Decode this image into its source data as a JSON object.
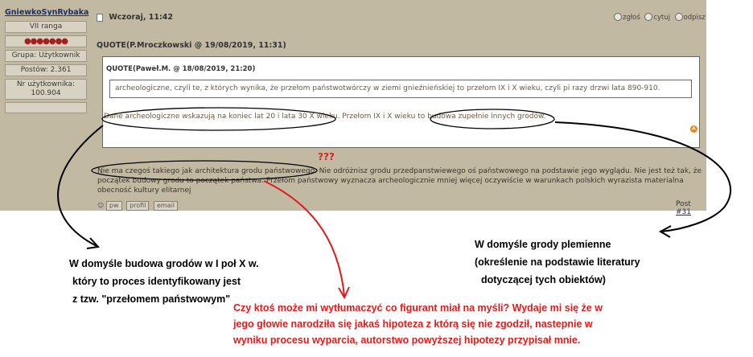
{
  "user": {
    "name": "GniewkoSynRybaka",
    "rank": "VII ranga",
    "group": "Grupa: Użytkownik",
    "posts": "Postów: 2.361",
    "number": "Nr użytkownika: 100.904"
  },
  "post": {
    "date": "Wczoraj, 11:42",
    "actions": {
      "report": "zgłoś",
      "quote": "cytuj",
      "reply": "odpisz"
    },
    "outer_quote_label": "QUOTE(P.Mroczkowski @ 19/08/2019, 11:31)",
    "inner_quote_label": "QUOTE(Paweł.M. @ 18/08/2019, 21:20)",
    "inner_quote_text": "archeologiczne, czyli te, z których wynika, że przełom państwotwórczy w ziemi gnieźnieńskiej to przełom IX i X wieku, czyli pi razy drzwi lata 890-910.",
    "quote_reply": "Dane archeologiczne wskazują na koniec lat 20 i lata 30 X wieku. Przełom IX i X wieku to budowa zupełnie innych grodów.",
    "body": "Nie ma czegoś takiego jak architektura grodu państwowego. Nie odróżnisz grodu przedpanstwiewego oś państwowego na podstawie jego wyglądu. Nie jest też tak, że początek budowy grodu to początek państwa. Przełom państwowy wyznacza archeologicznie mniej więcej oczywiście w warunkach polskich wyrazista materialna obecność kultury elitarnej",
    "links": {
      "pw": "pw",
      "profile": "profil",
      "email": "email"
    },
    "post_label": "Post",
    "post_number": "#31"
  },
  "annotations": {
    "question_marks": "???",
    "left_note": [
      "W domyśle budowa grodów w I poł X w.",
      "który to proces identyfikowany jest",
      "z tzw. \"przełomem państwowym\""
    ],
    "right_note": [
      "W domyśle grody plemienne",
      "(określenie na podstawie literatury",
      "dotyczącej tych obiektów)"
    ],
    "red_note": [
      "Czy ktoś może mi wytłumaczyć co figurant miał na myśli? Wydaje mi się że w",
      "jego głowie narodziła się jakaś hipoteza z którą się nie zgodził, nastepnie w",
      "wyniku procesu wyparcia, autorstwo powyższej hipotezy przypisał mnie."
    ],
    "colors": {
      "red": "#e01b1b",
      "black": "#000000"
    }
  }
}
